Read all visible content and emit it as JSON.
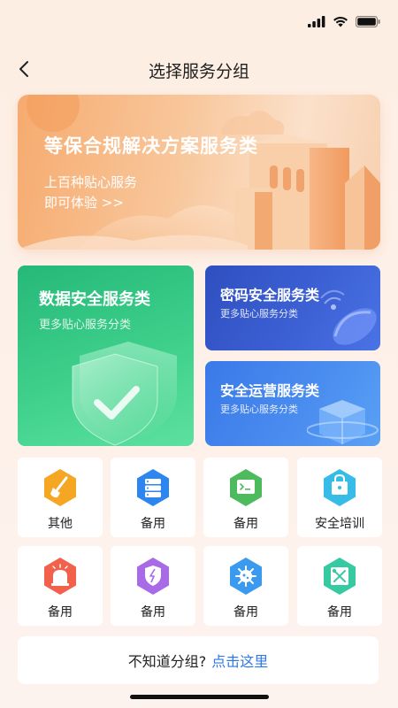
{
  "header": {
    "title": "选择服务分组"
  },
  "banner": {
    "title": "等保合规解决方案服务类",
    "subtitle": "上百种贴心服务",
    "cta": "即可体验 >>"
  },
  "cards": [
    {
      "title": "数据安全服务类",
      "subtitle": "更多贴心服务分类"
    },
    {
      "title": "密码安全服务类",
      "subtitle": "更多贴心服务分类"
    },
    {
      "title": "安全运营服务类",
      "subtitle": "更多贴心服务分类"
    }
  ],
  "grid": [
    {
      "label": "其他",
      "icon": "broom-icon",
      "color": "#f5a623"
    },
    {
      "label": "备用",
      "icon": "server-icon",
      "color": "#2d86f0"
    },
    {
      "label": "备用",
      "icon": "terminal-icon",
      "color": "#4dbb5d"
    },
    {
      "label": "安全培训",
      "icon": "lock-icon",
      "color": "#35bde8"
    },
    {
      "label": "备用",
      "icon": "alarm-icon",
      "color": "#f2614b"
    },
    {
      "label": "备用",
      "icon": "shield-icon",
      "color": "#a86ae6"
    },
    {
      "label": "备用",
      "icon": "virus-icon",
      "color": "#3a9af0"
    },
    {
      "label": "备用",
      "icon": "tools-icon",
      "color": "#36c9a2"
    }
  ],
  "help": {
    "text": "不知道分组?",
    "link": "点击这里"
  },
  "colors": {
    "link": "#2f78e6",
    "banner": "#f6ab6f",
    "green": "#2bbd7c",
    "blue": "#3d62d6"
  }
}
